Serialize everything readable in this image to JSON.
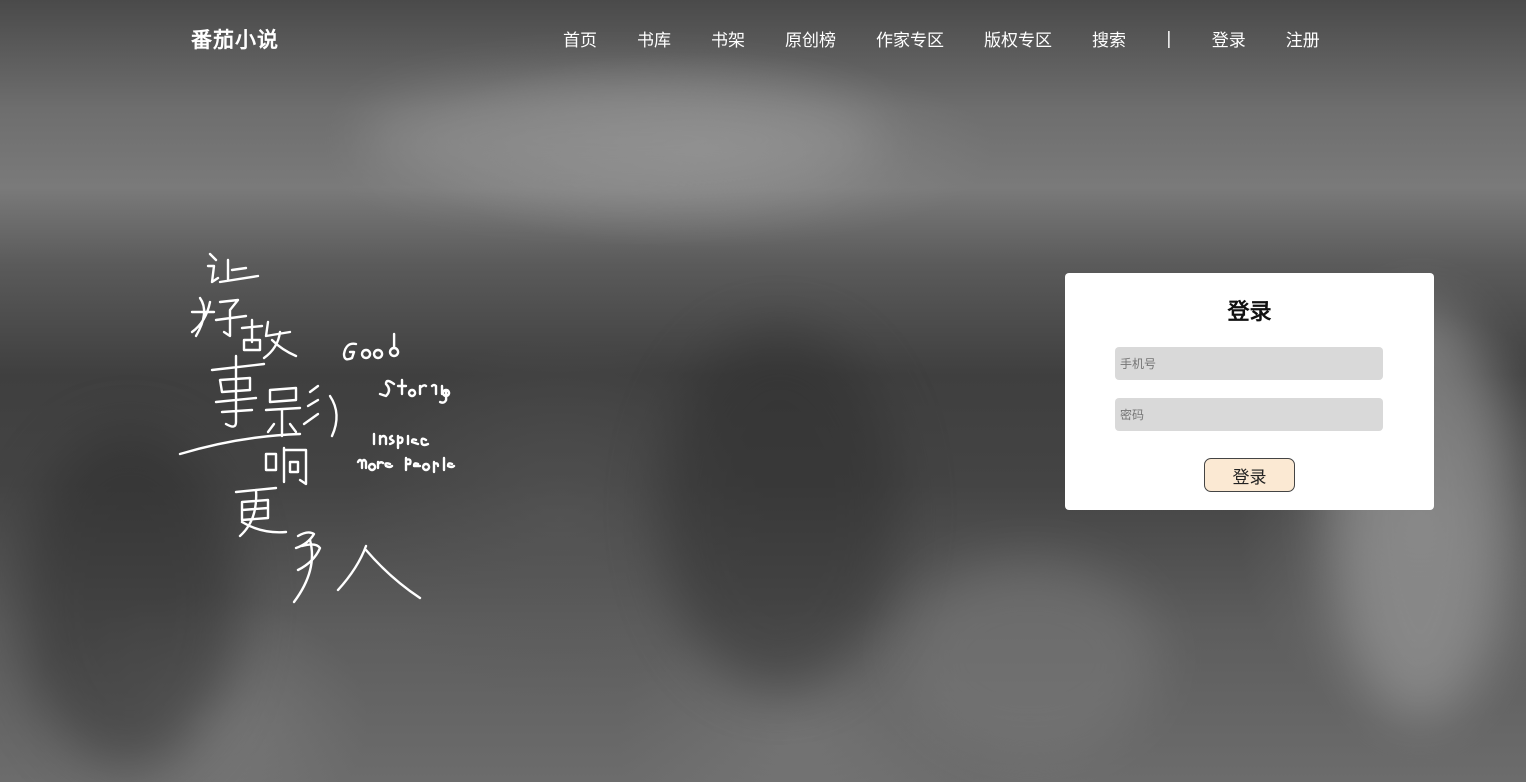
{
  "header": {
    "logo": "番茄小说",
    "nav": {
      "home": "首页",
      "library": "书库",
      "bookshelf": "书架",
      "original_ranking": "原创榜",
      "author_zone": "作家专区",
      "copyright_zone": "版权专区",
      "search": "搜索",
      "separator": "|",
      "login": "登录",
      "register": "注册"
    }
  },
  "slogan": {
    "chinese_lines": [
      "让",
      "好故",
      "事影",
      "响",
      "更多人"
    ],
    "english_lines": [
      "Good",
      "Stories",
      "Inspire",
      "more People"
    ]
  },
  "login_card": {
    "title": "登录",
    "phone_placeholder": "手机号",
    "password_placeholder": "密码",
    "submit_label": "登录"
  },
  "colors": {
    "nav_text": "#ffffff",
    "card_background": "#ffffff",
    "input_background": "#d9d9d9",
    "button_background": "#fbe9d3"
  }
}
